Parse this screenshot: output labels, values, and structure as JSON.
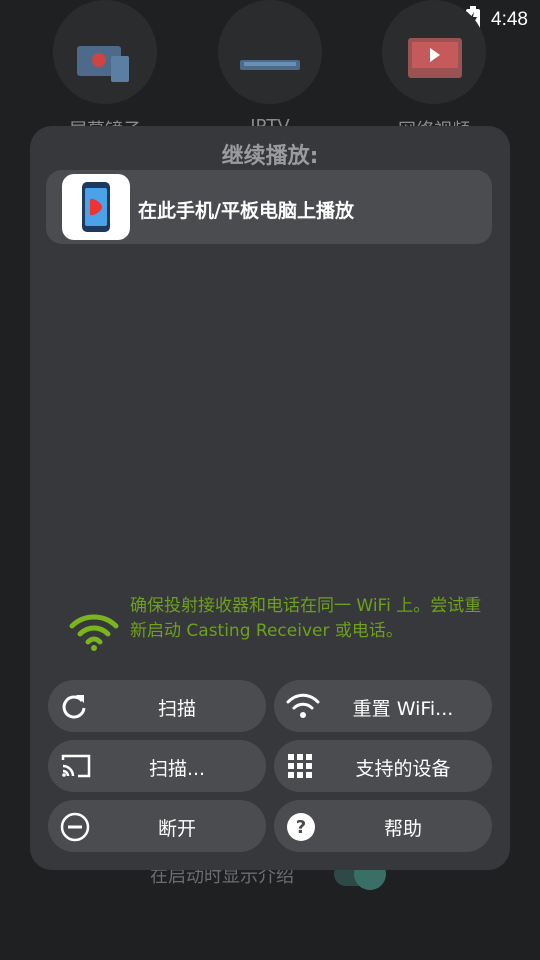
{
  "status_bar": {
    "time": "4:48"
  },
  "background": {
    "features": [
      {
        "label": "屏幕镜子"
      },
      {
        "label": "IPTV"
      },
      {
        "label": "网络视频"
      }
    ],
    "intro_toggle": {
      "label": "在启动时显示介绍",
      "on": true
    }
  },
  "dialog": {
    "title": "继续播放:",
    "device": {
      "label": "在此手机/平板电脑上播放"
    },
    "hint": "确保投射接收器和电话在同一 WiFi 上。尝试重新启动 Casting Receiver 或电话。",
    "buttons": [
      {
        "label": "扫描",
        "icon": "refresh-icon"
      },
      {
        "label": "重置 WiFi...",
        "icon": "wifi-icon"
      },
      {
        "label": "扫描...",
        "icon": "cast-icon"
      },
      {
        "label": "支持的设备",
        "icon": "grid-icon"
      },
      {
        "label": "断开",
        "icon": "minus-circle-icon"
      },
      {
        "label": "帮助",
        "icon": "help-icon"
      }
    ]
  },
  "colors": {
    "dialog_bg": "#36383b",
    "button_bg": "#4a4c4f",
    "hint_green": "#6ea01c",
    "wifi_green": "#7ab51d",
    "toggle_accent": "#3a6f67"
  }
}
